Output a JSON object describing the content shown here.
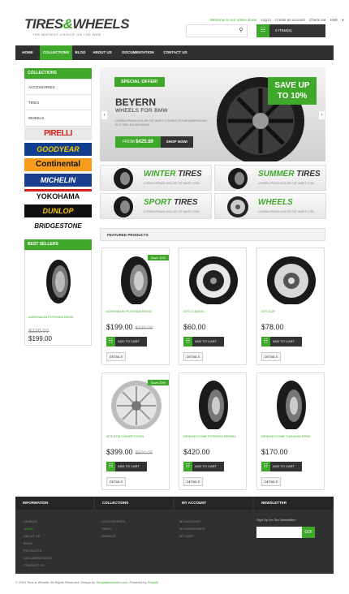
{
  "header": {
    "logo_a": "TIRES",
    "logo_amp": "&",
    "logo_b": "WHEELS",
    "tagline": "THE BIGGEST CHOICE ON THE WEB",
    "top_links": {
      "welcome": "Welcome to our online store!",
      "login": "Log in",
      "create": "Create an account",
      "checkout": "Check out",
      "currency": "USD"
    },
    "cart_label": "0 ITEM(S)"
  },
  "nav": [
    "HOME",
    "COLLECTIONS",
    "BLOG",
    "ABOUT US",
    "DOCUMENTATION",
    "CONTACT US"
  ],
  "sidebar": {
    "collections_title": "COLLECTIONS",
    "collections": [
      "ACCESSORIES",
      "TIRES",
      "WHEELS"
    ],
    "brands": [
      "PIRELLI",
      "GOODYEAR",
      "Continental",
      "MICHELIN",
      "YOKOHAMA",
      "DUNLOP",
      "BRIDGESTONE"
    ],
    "best_sellers_title": "BEST SELLERS",
    "best_seller": {
      "name": "ADRENALIN POTENZA RE001",
      "old_price": "$220.00",
      "price": "$199.00"
    }
  },
  "slider": {
    "offer": "SPECIAL OFFER!",
    "title": "BEYERN",
    "subtitle": "WHEELS FOR BMW",
    "text": "LOREM IPSUM DOLOR SIT AMET CONSECTETUR ADIPISICING ELIT SED DO EIUSMOD",
    "price_prefix": "FROM",
    "price": "$425.89",
    "shop": "SHOP NOW!",
    "save_line1": "SAVE UP",
    "save_line2": "TO 10%"
  },
  "tiles": [
    {
      "a": "WINTER",
      "b": "TIRES",
      "sub": "LOREM IPSUM DOLOR SIT AMET CON"
    },
    {
      "a": "SUMMER",
      "b": "TIRES",
      "sub": "LOREM IPSUM DOLOR SIT AMET CON"
    },
    {
      "a": "SPORT",
      "b": "TIRES",
      "sub": "LOREM IPSUM DOLOR SIT AMET CON"
    },
    {
      "a": "WHEELS",
      "b": "",
      "sub": "LOREM IPSUM DOLOR SIT AMET CON"
    }
  ],
  "featured_title": "FEATURED PRODUCTS",
  "products": [
    {
      "name": "ADRENALIN POTENZA RE001",
      "price": "$199.00",
      "old": "$220.00",
      "badge": "Save 10%"
    },
    {
      "name": "ATS CLASSIC",
      "price": "$60.00",
      "old": "",
      "badge": ""
    },
    {
      "name": "ATS CUP",
      "price": "$78.00",
      "old": "",
      "badge": ""
    },
    {
      "name": "ATS DTM COMPETITION",
      "price": "$399.00",
      "old": "$500.00",
      "badge": "Save 20%"
    },
    {
      "name": "BRIDGESTONE POTENZA RE050A",
      "price": "$420.00",
      "old": "",
      "badge": ""
    },
    {
      "name": "BRIDGESTONE TURANZA ER30",
      "price": "$170.00",
      "old": "",
      "badge": ""
    }
  ],
  "buttons": {
    "add_to_cart": "ADD TO CART",
    "details": "DETAILS",
    "go": "GO!"
  },
  "footer": {
    "information_title": "INFORMATION",
    "information": [
      "SEARCH",
      "HOME",
      "ABOUT US",
      "BLOG",
      "PRODUCTS",
      "DOCUMENTATION",
      "CONTACT US"
    ],
    "collections_title": "COLLECTIONS",
    "collections": [
      "ACCESSORIES",
      "TIRES",
      "WHEELS"
    ],
    "account_title": "MY ACCOUNT",
    "account": [
      "MY ACCOUNT",
      "MY ADDRESSES",
      "MY CART"
    ],
    "newsletter_title": "NEWSLETTER",
    "newsletter_text": "Sign Up for Our Newsletter:",
    "copy_a": "© 2014 Tires & Wheels. All Rights Reserved. Design by",
    "copy_link": "TemplateMonster.com",
    "copy_b": ". Powered by",
    "copy_shopify": "Shopify"
  },
  "colors": {
    "accent": "#3fa82a",
    "dark": "#303030"
  }
}
